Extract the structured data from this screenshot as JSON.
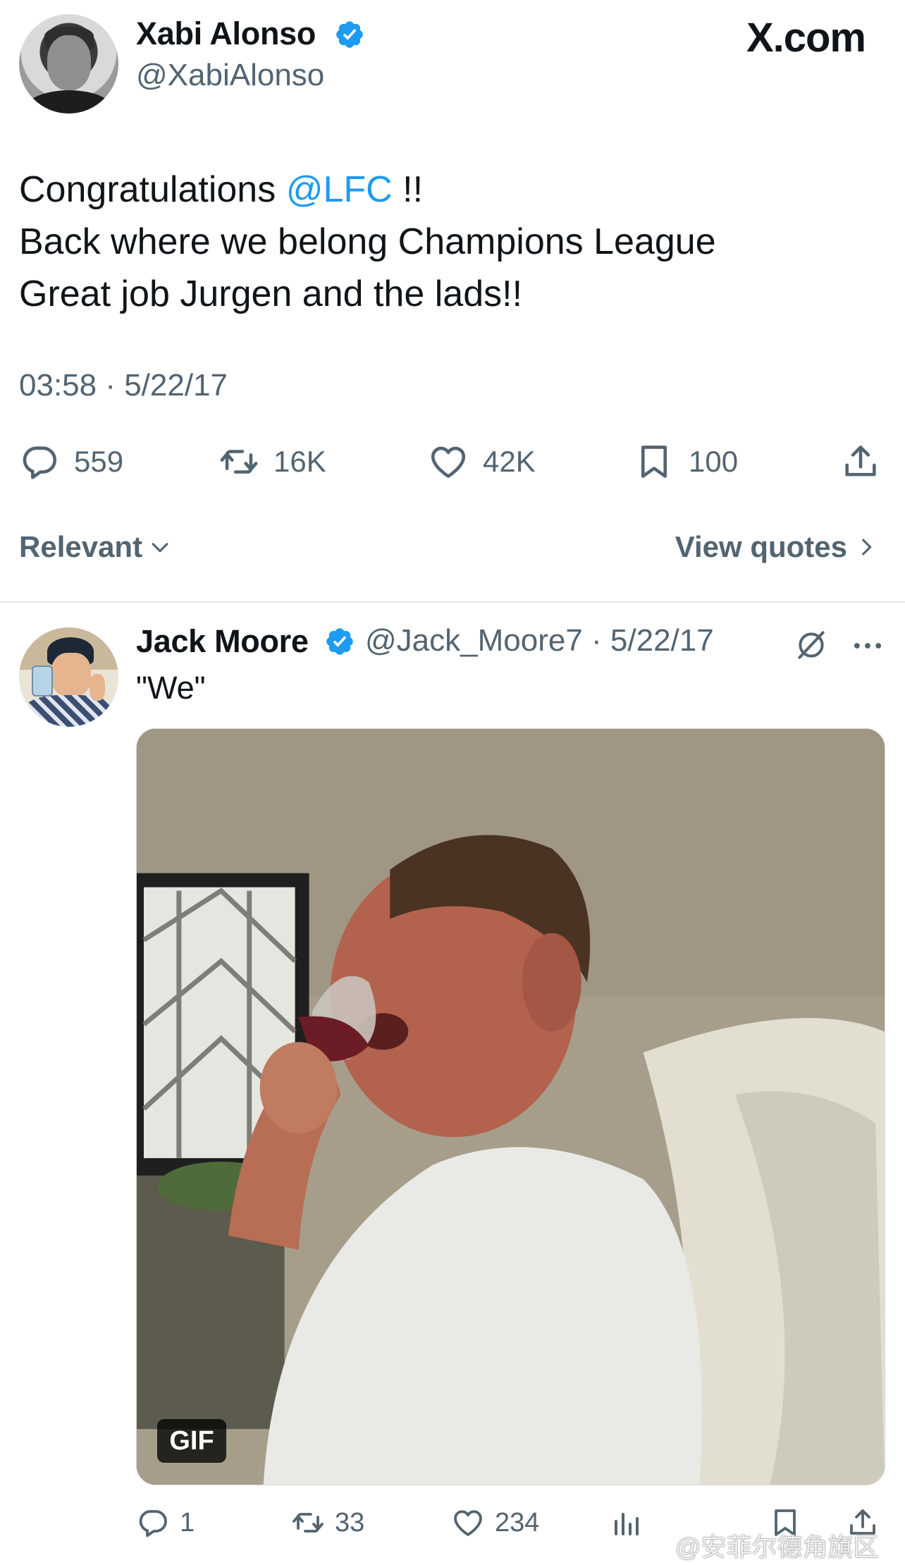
{
  "brand": "X.com",
  "main_tweet": {
    "author_name": "Xabi Alonso",
    "author_handle": "@XabiAlonso",
    "verified": true,
    "text_line1_prefix": "Congratulations ",
    "text_mention": "@LFC",
    "text_line1_suffix": " !!",
    "text_line2": "Back where we belong Champions League",
    "text_line3": "Great job Jurgen and the lads!!",
    "timestamp": "03:58 · 5/22/17",
    "replies": "559",
    "reposts": "16K",
    "likes": "42K",
    "bookmarks": "100"
  },
  "controls": {
    "sort_label": "Relevant",
    "view_quotes_label": "View quotes"
  },
  "reply_tweet": {
    "author_name": "Jack Moore",
    "author_handle_date": "@Jack_Moore7 · 5/22/17",
    "verified": true,
    "text": "\"We\"",
    "media_badge": "GIF",
    "replies": "1",
    "reposts": "33",
    "likes": "234"
  },
  "watermark": "@安菲尔德角旗区",
  "colors": {
    "accent": "#1d9bf0",
    "secondary_text": "#536471",
    "primary_text": "#0f1419",
    "divider": "#e4e8eb"
  },
  "icons": [
    "verified-badge-icon",
    "reply-icon",
    "repost-icon",
    "like-icon",
    "bookmark-icon",
    "share-icon",
    "chevron-down-icon",
    "chevron-right-icon",
    "grok-icon",
    "more-icon",
    "views-icon"
  ]
}
